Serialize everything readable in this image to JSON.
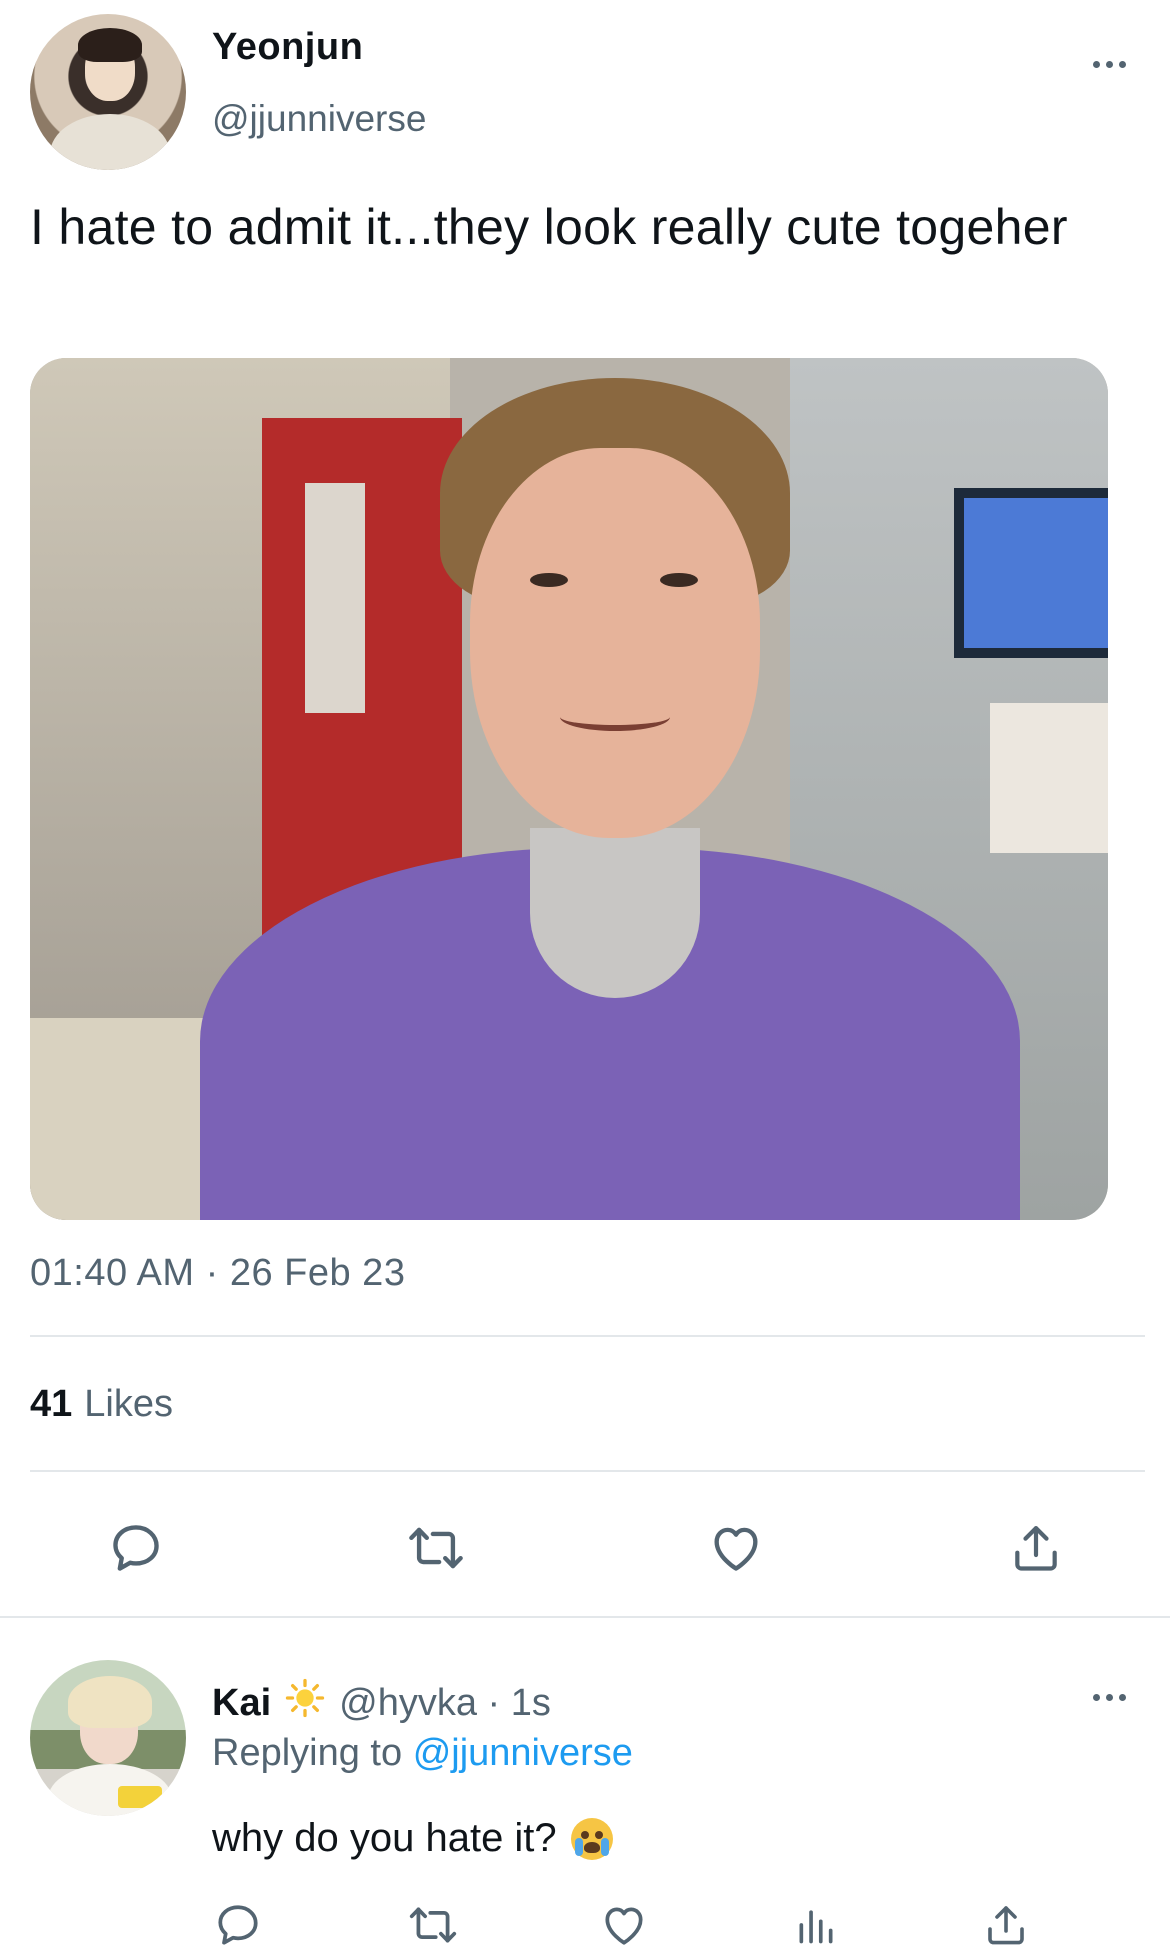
{
  "tweet": {
    "author_name": "Yeonjun",
    "author_handle": "@jjunniverse",
    "text": "I hate to admit it...they look really cute togeher",
    "timestamp": "01:40 AM · 26 Feb 23",
    "likes_count": "41",
    "likes_label": "Likes"
  },
  "reply": {
    "author_name": "Kai",
    "author_handle": "@hyvka · 1s",
    "replying_prefix": "Replying to",
    "replying_to": "@jjunniverse",
    "text": "why do you hate it?"
  },
  "colors": {
    "text_primary": "#0f1419",
    "text_secondary": "#536471",
    "link": "#1d9bf0",
    "divider": "#e3e7ea"
  },
  "icons": {
    "more": "more-dots-icon",
    "reply": "speech-bubble-icon",
    "retweet": "retweet-icon",
    "like": "heart-icon",
    "share": "share-upload-icon",
    "analytics": "bar-chart-icon",
    "sun_emoji": "sun-icon",
    "crying_emoji": "crying-face-icon"
  }
}
